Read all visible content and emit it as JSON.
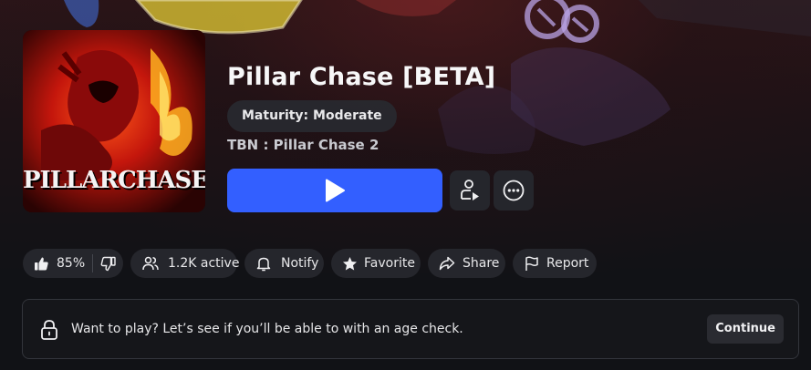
{
  "game": {
    "title": "Pillar Chase [BETA]",
    "maturity": "Maturity: Moderate",
    "creator": "TBN : Pillar Chase 2",
    "thumbnail_text": "PILLARCHASE"
  },
  "actions": {
    "play_icon": "play-icon",
    "secondary_icon": "person-play-icon",
    "more_icon": "more-horizontal-icon"
  },
  "stats": {
    "like_percent": "85%",
    "active": "1.2K active",
    "notify": "Notify",
    "favorite": "Favorite",
    "share": "Share",
    "report": "Report"
  },
  "age_check": {
    "message": "Want to play? Let’s see if you’ll be able to with an age check.",
    "continue_label": "Continue"
  },
  "colors": {
    "accent": "#335fff",
    "background": "#111216",
    "chip": "#25262c"
  }
}
